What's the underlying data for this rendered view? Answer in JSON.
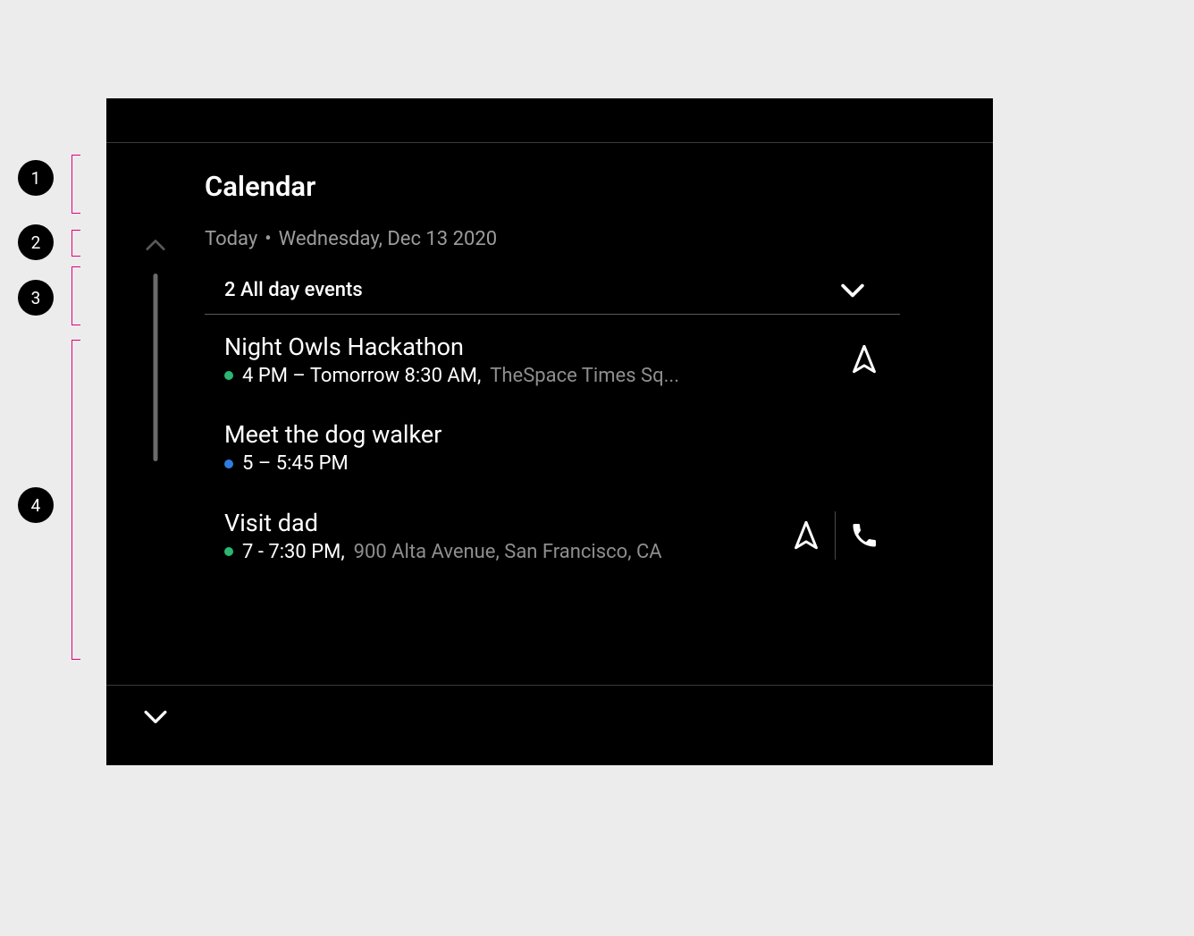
{
  "header": {
    "title": "Calendar"
  },
  "date": {
    "label": "Today",
    "separator": "•",
    "full": "Wednesday, Dec 13 2020"
  },
  "allday": {
    "label": "2 All day events"
  },
  "events": [
    {
      "title": "Night Owls Hackathon",
      "dot": "green",
      "time": "4 PM – Tomorrow 8:30 AM,",
      "location": "TheSpace Times Sq...",
      "nav": true,
      "call": false
    },
    {
      "title": "Meet the dog walker",
      "dot": "blue",
      "time": "5 – 5:45 PM",
      "location": "",
      "nav": false,
      "call": false
    },
    {
      "title": "Visit dad",
      "dot": "green",
      "time": "7 - 7:30 PM,",
      "location": "900 Alta Avenue, San Francisco, CA",
      "nav": true,
      "call": true
    }
  ],
  "annotations": [
    "1",
    "2",
    "3",
    "4"
  ]
}
